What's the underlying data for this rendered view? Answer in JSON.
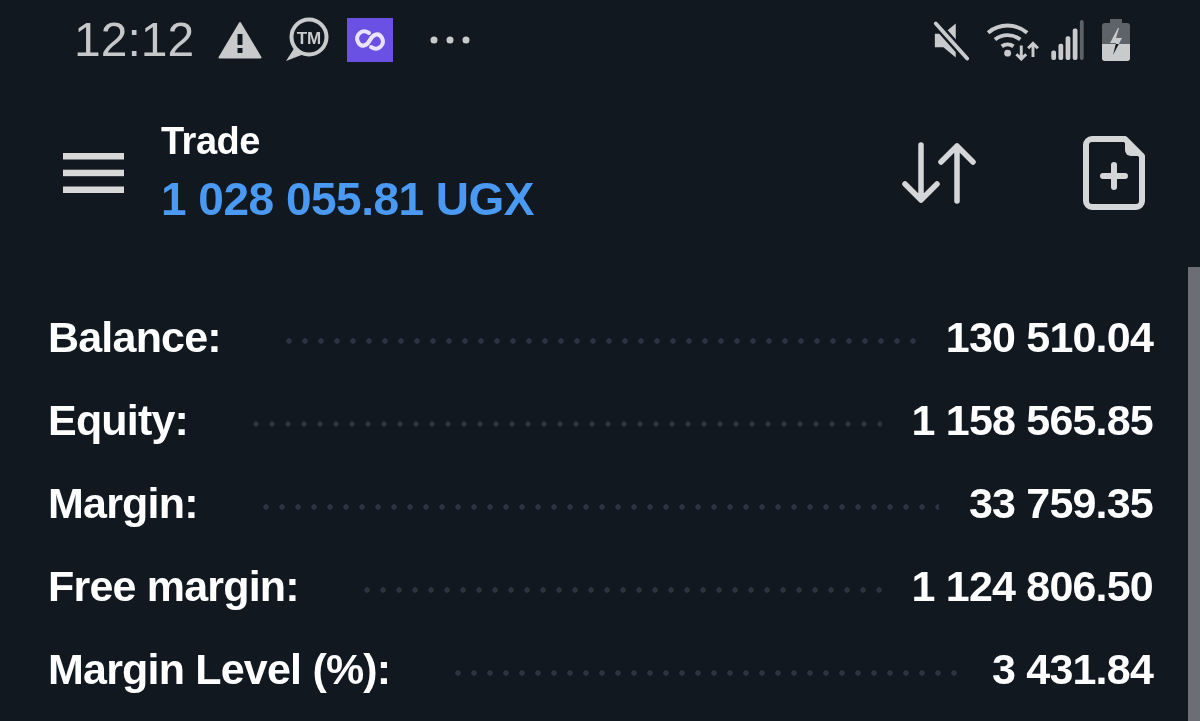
{
  "status_bar": {
    "time": "12:12",
    "chat_badge": "TM"
  },
  "header": {
    "title": "Trade",
    "balance": "1 028 055.81 UGX"
  },
  "account_summary": [
    {
      "label": "Balance:",
      "value": "130 510.04"
    },
    {
      "label": "Equity:",
      "value": "1 158 565.85"
    },
    {
      "label": "Margin:",
      "value": "33 759.35"
    },
    {
      "label": "Free margin:",
      "value": "1 124 806.50"
    },
    {
      "label": "Margin Level (%):",
      "value": "3 431.84"
    }
  ]
}
